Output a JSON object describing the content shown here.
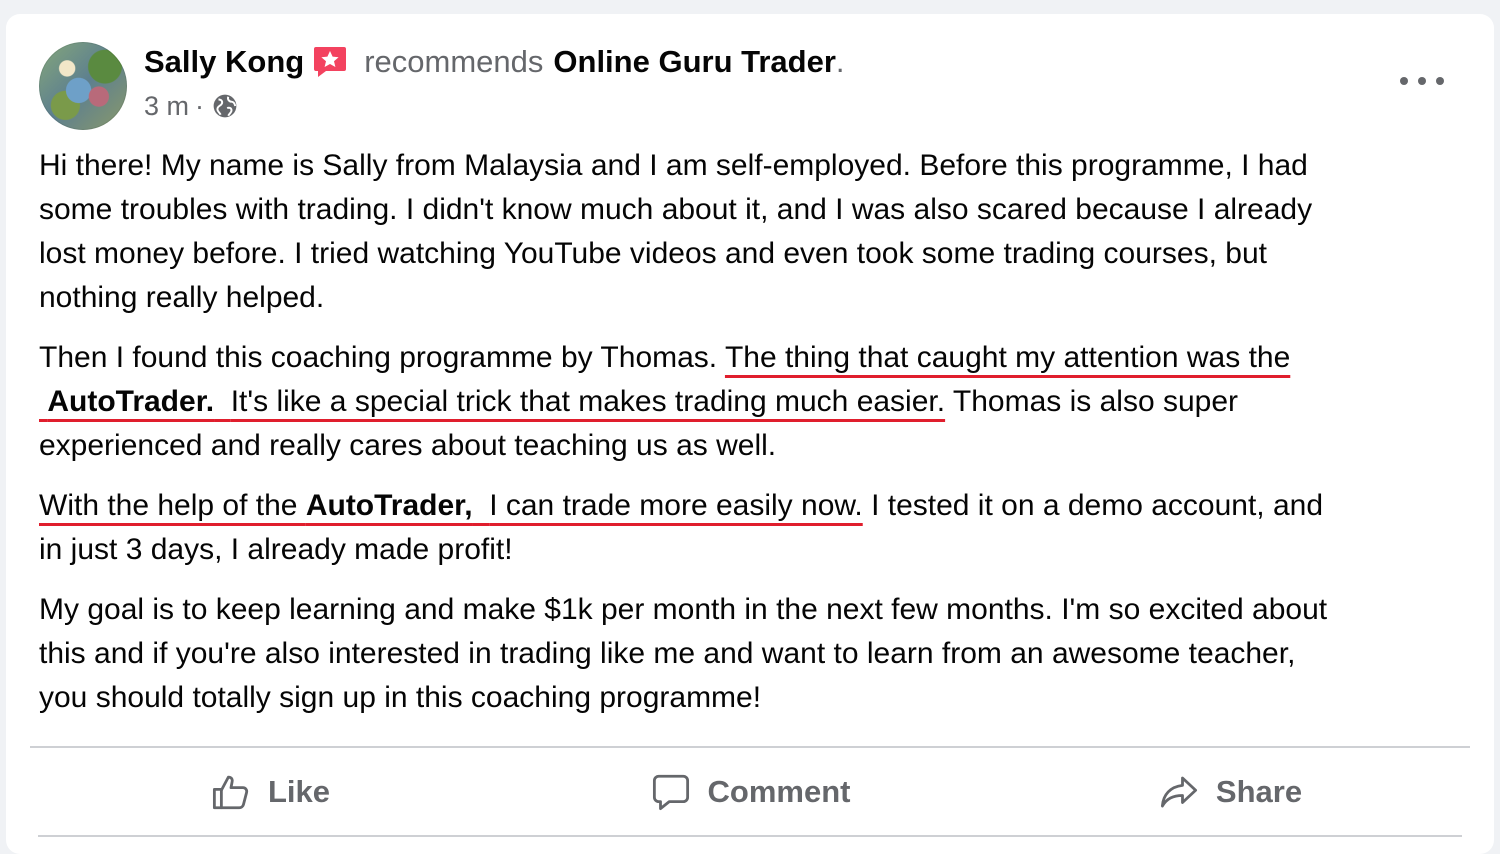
{
  "post": {
    "author": "Sally Kong",
    "verb": "recommends",
    "page_name": "Online Guru Trader",
    "page_suffix": ".",
    "time": "3 m",
    "separator": "·"
  },
  "body": {
    "p1": [
      "Hi there! My name is Sally from Malaysia and I am self-employed. Before this programme, I had",
      "some troubles with trading. I didn't know much about it, and I was also scared because I already",
      "lost money before. I tried watching YouTube videos and even took some trading courses, but",
      "nothing really helped."
    ],
    "p2": {
      "l1_plain": "Then I found this coaching programme by Thomas. ",
      "l1_underlined": "The thing that caught my attention was the",
      "l2_bold": "AutoTrader.",
      "l2_underlined": "It's like a special trick that makes trading much easier.",
      "l2_plain": " Thomas is also super",
      "l3_plain": "experienced and really cares about teaching us as well."
    },
    "p3": {
      "l1_underlined_a": "With the help of the ",
      "l1_bold": "AutoTrader,",
      "l1_underlined_b": "I can trade more easily now.",
      "l1_plain": " I tested it on a demo account, and",
      "l2_plain": "in just 3 days, I already made profit!"
    },
    "p4": [
      "My goal is to keep learning and make $1k per month in the next few months. I'm so excited about",
      "this and if you're also interested in trading like me and want to learn from an awesome teacher,",
      "you should totally sign up in this coaching programme!"
    ]
  },
  "actions": {
    "like": "Like",
    "comment": "Comment",
    "share": "Share"
  },
  "icons": {
    "recommend_badge": "recommend-badge-icon",
    "privacy": "globe-icon",
    "more": "more-options-icon",
    "like": "thumbs-up-icon",
    "comment": "comment-bubble-icon",
    "share": "share-arrow-icon"
  },
  "colors": {
    "badge": "#f3425f",
    "underline": "#e01e2d",
    "secondary_text": "#65676b"
  }
}
